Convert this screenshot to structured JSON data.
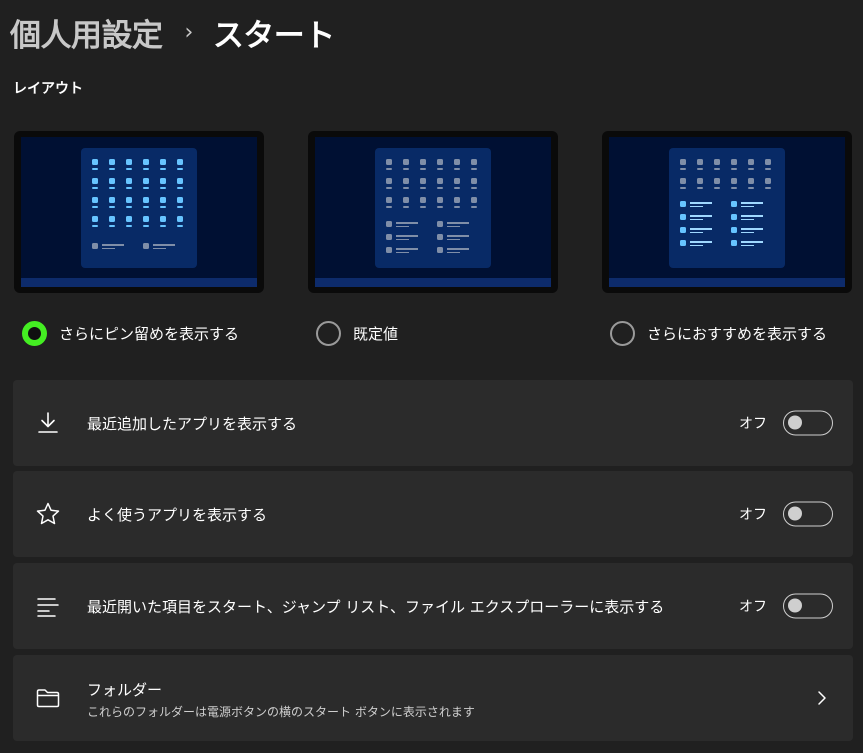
{
  "breadcrumb": {
    "parent": "個人用設定",
    "separator": "›",
    "current": "スタート"
  },
  "layout_section": {
    "title": "レイアウト",
    "options": [
      {
        "label": "さらにピン留めを表示する",
        "selected": true
      },
      {
        "label": "既定値",
        "selected": false
      },
      {
        "label": "さらにおすすめを表示する",
        "selected": false
      }
    ]
  },
  "settings": [
    {
      "icon": "download-icon",
      "label": "最近追加したアプリを表示する",
      "state_label": "オフ",
      "on": false
    },
    {
      "icon": "star-icon",
      "label": "よく使うアプリを表示する",
      "state_label": "オフ",
      "on": false
    },
    {
      "icon": "list-icon",
      "label": "最近開いた項目をスタート、ジャンプ リスト、ファイル エクスプローラーに表示する",
      "state_label": "オフ",
      "on": false
    },
    {
      "icon": "folder-icon",
      "label": "フォルダー",
      "description": "これらのフォルダーは電源ボタンの横のスタート ボタンに表示されます"
    }
  ],
  "colors": {
    "accent": "#44ee22",
    "background": "#202020",
    "card": "#2b2b2b",
    "preview_pin_active": "#67c4ff",
    "preview_pin_inactive": "#7f8ea8"
  }
}
